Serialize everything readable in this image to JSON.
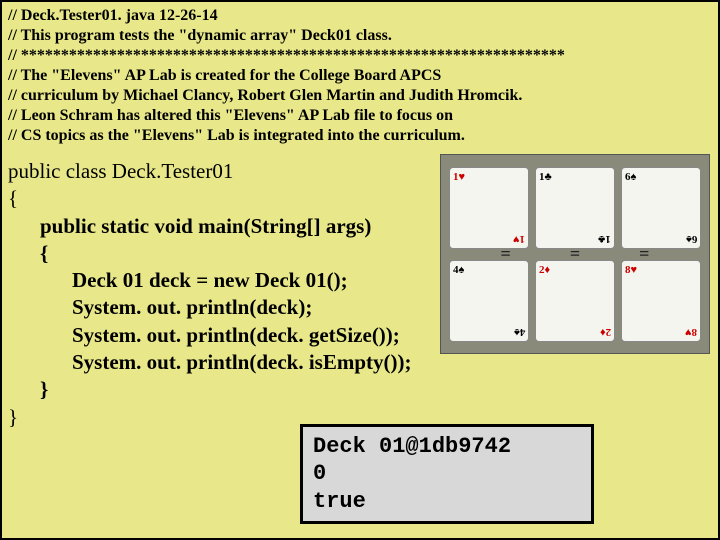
{
  "comments": {
    "line1": "// Deck.Tester01. java     12-26-14",
    "line2": "// This program tests the \"dynamic array\" Deck01 class.",
    "line3": "// ********************************************************************",
    "line4": "// The \"Elevens\" AP Lab is created for the College Board APCS",
    "line5": "// curriculum by Michael Clancy, Robert Glen Martin and Judith Hromcik.",
    "line6": "// Leon Schram has altered this \"Elevens\" AP Lab file to focus on",
    "line7": "// CS topics as the \"Elevens\" Lab is integrated into the curriculum."
  },
  "code": {
    "class_decl": "public class Deck.Tester01",
    "brace_open": "{",
    "main_sig": "public static void main(String[] args)",
    "main_open": "{",
    "stmt1": "Deck 01 deck = new Deck 01();",
    "stmt2": "System. out. println(deck);",
    "stmt3": "System. out. println(deck. getSize());",
    "stmt4": "System. out. println(deck. isEmpty());",
    "main_close": "}",
    "brace_close": "}"
  },
  "output": {
    "line1": "Deck 01@1db9742",
    "line2": "0",
    "line3": "true"
  },
  "cards": {
    "top": [
      {
        "rank": "1",
        "suit": "♥",
        "color": "red"
      },
      {
        "rank": "1",
        "suit": "♣",
        "color": "black"
      },
      {
        "rank": "6",
        "suit": "♠",
        "color": "black"
      }
    ],
    "bottom": [
      {
        "rank": "4",
        "suit": "♠",
        "color": "black"
      },
      {
        "rank": "2",
        "suit": "♦",
        "color": "red"
      },
      {
        "rank": "8",
        "suit": "♥",
        "color": "red"
      }
    ],
    "ops_top": [
      "−",
      "+",
      "="
    ],
    "eq_mid": [
      "=",
      "=",
      "="
    ]
  }
}
